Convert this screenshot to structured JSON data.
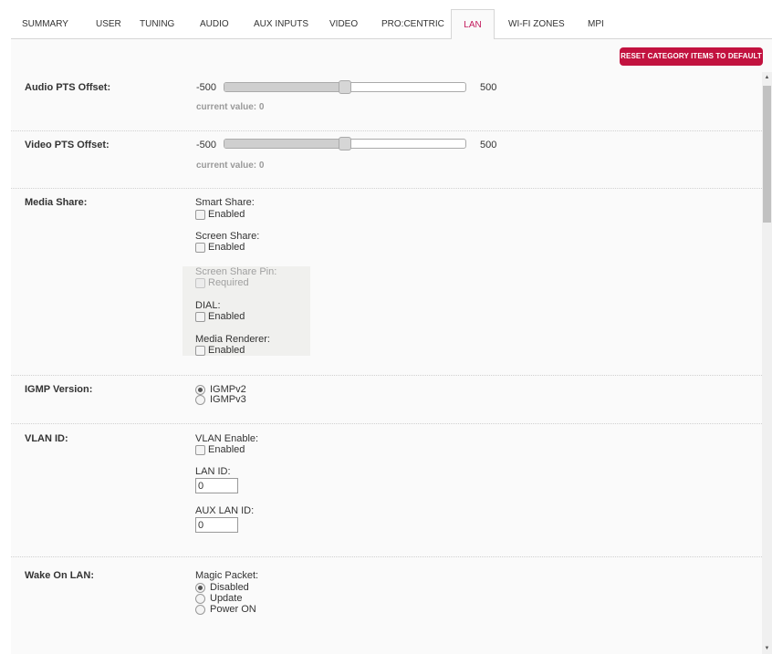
{
  "tabs": [
    {
      "label": "SUMMARY"
    },
    {
      "label": "USER"
    },
    {
      "label": "TUNING"
    },
    {
      "label": "AUDIO"
    },
    {
      "label": "AUX INPUTS"
    },
    {
      "label": "VIDEO"
    },
    {
      "label": "PRO:CENTRIC"
    },
    {
      "label": "LAN"
    },
    {
      "label": "WI-FI ZONES"
    },
    {
      "label": "MPI"
    }
  ],
  "active_tab": "LAN",
  "reset_button": "RESET CATEGORY ITEMS TO DEFAULT",
  "audio_pts": {
    "label": "Audio PTS Offset:",
    "min": "-500",
    "max": "500",
    "value_fraction": 0.5,
    "current_value": "current value: 0"
  },
  "video_pts": {
    "label": "Video PTS Offset:",
    "min": "-500",
    "max": "500",
    "value_fraction": 0.5,
    "current_value": "current value: 0"
  },
  "media_share": {
    "label": "Media Share:",
    "smart_share": {
      "label": "Smart Share:",
      "option": "Enabled",
      "checked": false
    },
    "screen_share": {
      "label": "Screen Share:",
      "option": "Enabled",
      "checked": false
    },
    "screen_share_pin": {
      "label": "Screen Share Pin:",
      "option": "Required",
      "checked": false,
      "disabled": true
    },
    "dial": {
      "label": "DIAL:",
      "option": "Enabled",
      "checked": false
    },
    "media_renderer": {
      "label": "Media Renderer:",
      "option": "Enabled",
      "checked": false
    }
  },
  "igmp": {
    "label": "IGMP Version:",
    "options": [
      "IGMPv2",
      "IGMPv3"
    ],
    "selected": "IGMPv2"
  },
  "vlan": {
    "label": "VLAN ID:",
    "enable_label": "VLAN Enable:",
    "enable_option": "Enabled",
    "lan_id_label": "LAN ID:",
    "lan_id_value": "0",
    "aux_lan_id_label": "AUX LAN ID:",
    "aux_lan_id_value": "0"
  },
  "wake_on_lan": {
    "label": "Wake On LAN:",
    "magic_packet_label": "Magic Packet:",
    "options": [
      "Disabled",
      "Update",
      "Power ON"
    ],
    "selected": "Disabled"
  },
  "scrollbar": {
    "up_glyph": "▲",
    "down_glyph": "▼"
  }
}
